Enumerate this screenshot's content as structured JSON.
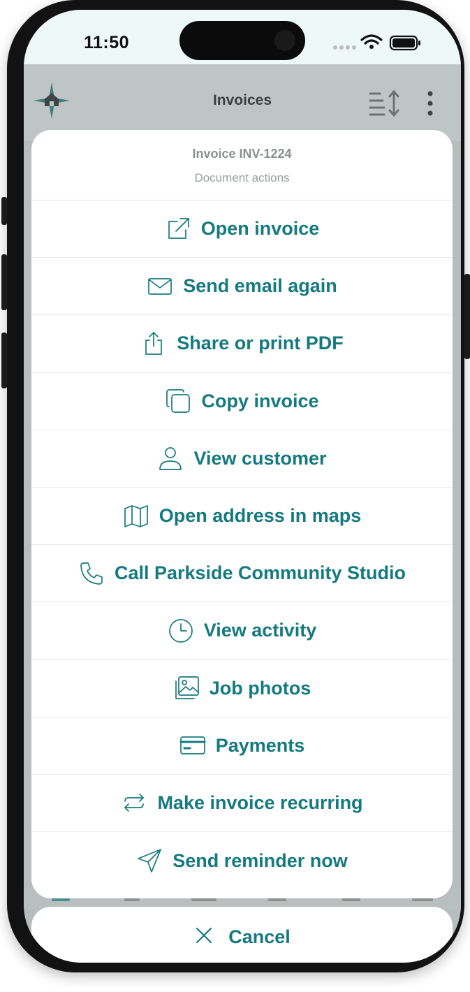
{
  "status_bar": {
    "time": "11:50"
  },
  "header": {
    "title": "Invoices"
  },
  "sheet": {
    "title": "Invoice INV-1224",
    "subtitle": "Document actions",
    "actions": [
      {
        "label": "Open invoice",
        "icon": "external-link-icon"
      },
      {
        "label": "Send email again",
        "icon": "mail-icon"
      },
      {
        "label": "Share or print PDF",
        "icon": "share-icon"
      },
      {
        "label": "Copy invoice",
        "icon": "copy-icon"
      },
      {
        "label": "View customer",
        "icon": "user-icon"
      },
      {
        "label": "Open address in maps",
        "icon": "map-icon"
      },
      {
        "label": "Call Parkside Community Studio",
        "icon": "phone-icon"
      },
      {
        "label": "View activity",
        "icon": "clock-icon"
      },
      {
        "label": "Job photos",
        "icon": "photos-icon"
      },
      {
        "label": "Payments",
        "icon": "credit-card-icon"
      },
      {
        "label": "Make invoice recurring",
        "icon": "repeat-icon"
      },
      {
        "label": "Send reminder now",
        "icon": "send-icon"
      }
    ],
    "cancel_label": "Cancel"
  },
  "colors": {
    "accent": "#157a7f",
    "overlay": "#b7bcbd",
    "status_bar_bg": "#eef8f6"
  }
}
